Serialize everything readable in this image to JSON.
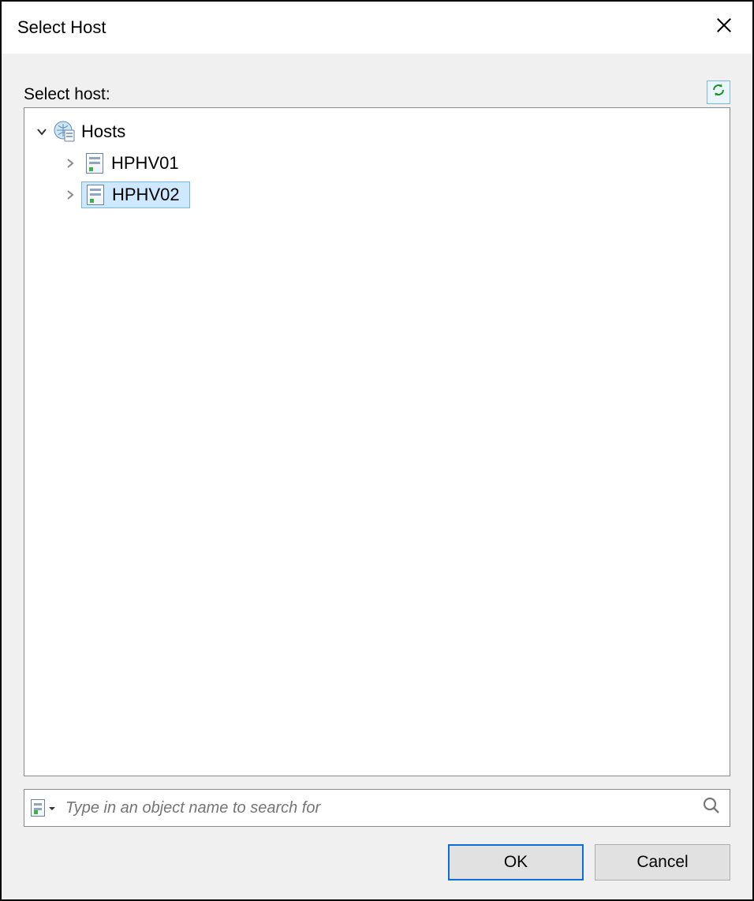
{
  "dialog": {
    "title": "Select Host",
    "label": "Select host:"
  },
  "tree": {
    "root": {
      "label": "Hosts",
      "expanded": true
    },
    "children": [
      {
        "label": "HPHV01",
        "expanded": false,
        "selected": false
      },
      {
        "label": "HPHV02",
        "expanded": false,
        "selected": true
      }
    ]
  },
  "search": {
    "placeholder": "Type in an object name to search for"
  },
  "buttons": {
    "ok": "OK",
    "cancel": "Cancel"
  }
}
